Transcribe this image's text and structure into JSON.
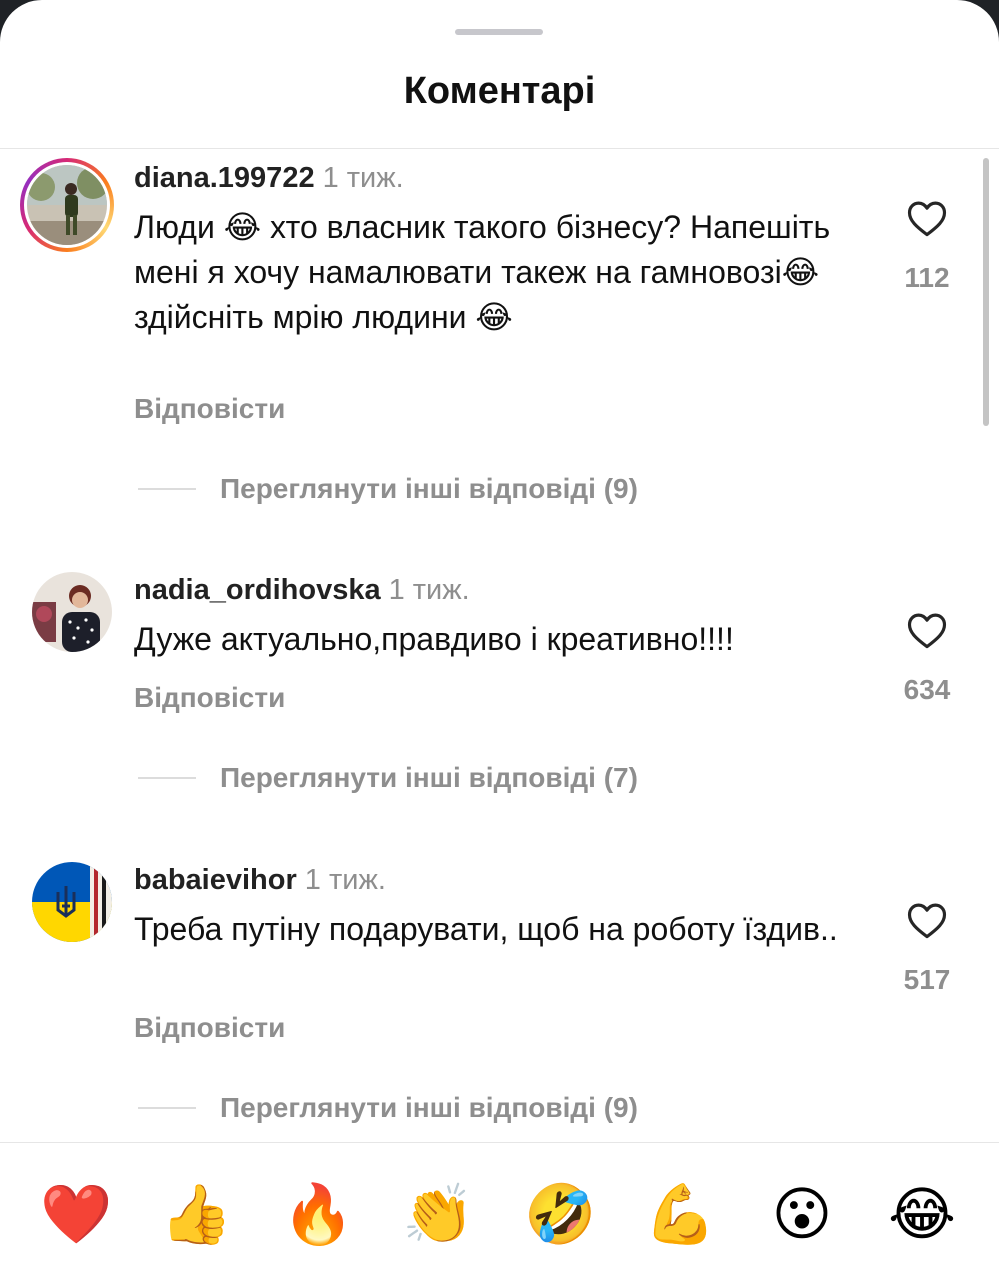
{
  "header": {
    "title": "Коментарі"
  },
  "comments": [
    {
      "username": "diana.199722",
      "time": "1 тиж.",
      "text": "Люди 😂 хто власник такого бізнесу? Напешіть мені я хочу намалювати такеж на гамновозі😂 здійсніть мрію людини 😂",
      "reply_label": "Відповісти",
      "likes": "112",
      "view_replies": "Переглянути інші відповіді (9)"
    },
    {
      "username": "nadia_ordihovska",
      "time": "1 тиж.",
      "text": "Дуже актуально,правдиво і креативно!!!!",
      "reply_label": "Відповісти",
      "likes": "634",
      "view_replies": "Переглянути інші відповіді (7)"
    },
    {
      "username": "babaievihor",
      "time": "1 тиж.",
      "text": "Треба путіну подарувати, щоб на роботу їздив..",
      "reply_label": "Відповісти",
      "likes": "517",
      "view_replies": "Переглянути інші відповіді (9)"
    }
  ],
  "reactions": [
    "❤️",
    "👍",
    "🔥",
    "👏",
    "🤣",
    "💪",
    "😮",
    "😂"
  ],
  "colors": {
    "text": "#111111",
    "secondary": "#8e8e8e",
    "story_ring": [
      "#d62976",
      "#fa7e1e",
      "#feda75"
    ],
    "heart_outline": "#262626"
  }
}
